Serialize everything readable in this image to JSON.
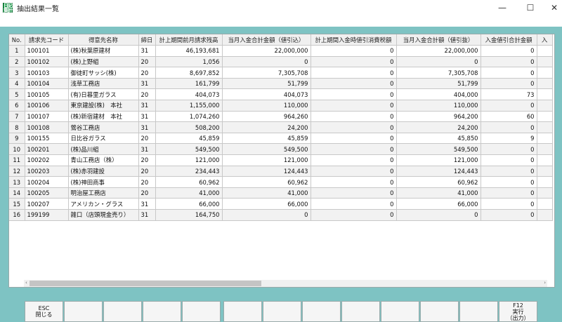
{
  "window": {
    "title": "抽出結果一覧",
    "icon_chars": [
      "日",
      "記",
      "集",
      "計"
    ],
    "min_glyph": "—",
    "max_glyph": "☐",
    "close_glyph": "✕"
  },
  "table": {
    "columns": [
      "No.",
      "請求先コード",
      "得意先名称",
      "締日",
      "計上期間前月請求残高",
      "当月入金合計金額（値引込）",
      "計上期間入金時値引消費税額",
      "当月入金合計額（値引抜）",
      "入金値引合計金額",
      "入"
    ],
    "rows": [
      [
        "1",
        "100101",
        "(株)秋葉原建材",
        "31",
        "46,193,681",
        "22,000,000",
        "0",
        "22,000,000",
        "0",
        ""
      ],
      [
        "2",
        "100102",
        "(株)上野組",
        "20",
        "1,056",
        "0",
        "0",
        "0",
        "0",
        ""
      ],
      [
        "3",
        "100103",
        "御徒町サッシ(株)",
        "20",
        "8,697,852",
        "7,305,708",
        "0",
        "7,305,708",
        "0",
        ""
      ],
      [
        "4",
        "100104",
        "浅草工務店",
        "31",
        "161,799",
        "51,799",
        "0",
        "51,799",
        "0",
        ""
      ],
      [
        "5",
        "100105",
        "(有)日暮里ガラス",
        "20",
        "404,073",
        "404,073",
        "0",
        "404,000",
        "73",
        ""
      ],
      [
        "6",
        "100106",
        "東京建設(株)　本社",
        "31",
        "1,155,000",
        "110,000",
        "0",
        "110,000",
        "0",
        ""
      ],
      [
        "7",
        "100107",
        "(株)新宿建材　本社",
        "31",
        "1,074,260",
        "964,260",
        "0",
        "964,200",
        "60",
        ""
      ],
      [
        "8",
        "100108",
        "鶯谷工務店",
        "31",
        "508,200",
        "24,200",
        "0",
        "24,200",
        "0",
        ""
      ],
      [
        "9",
        "100155",
        "日比谷ガラス",
        "20",
        "45,859",
        "45,859",
        "0",
        "45,850",
        "9",
        ""
      ],
      [
        "10",
        "100201",
        "(株)品川組",
        "31",
        "549,500",
        "549,500",
        "0",
        "549,500",
        "0",
        ""
      ],
      [
        "11",
        "100202",
        "青山工務店（株）",
        "20",
        "121,000",
        "121,000",
        "0",
        "121,000",
        "0",
        ""
      ],
      [
        "12",
        "100203",
        "(株)赤羽建設",
        "20",
        "234,443",
        "124,443",
        "0",
        "124,443",
        "0",
        ""
      ],
      [
        "13",
        "100204",
        "(株)神田商事",
        "20",
        "60,962",
        "60,962",
        "0",
        "60,962",
        "0",
        ""
      ],
      [
        "14",
        "100205",
        "明治屋工務店",
        "20",
        "41,000",
        "41,000",
        "0",
        "41,000",
        "0",
        ""
      ],
      [
        "15",
        "100207",
        "アメリカン・グラス",
        "31",
        "66,000",
        "66,000",
        "0",
        "66,000",
        "0",
        ""
      ],
      [
        "16",
        "199199",
        "雑口（店頭現金売り）",
        "31",
        "164,750",
        "0",
        "0",
        "0",
        "0",
        ""
      ]
    ]
  },
  "scrollbar": {
    "left_arrow": "‹",
    "right_arrow": "›"
  },
  "function_keys": {
    "esc": {
      "line1": "ESC",
      "line2": "閉じる"
    },
    "f12": {
      "line1": "F12",
      "line2": "実行",
      "line3": "（出力）"
    }
  },
  "colors": {
    "background": "#7ec3c3",
    "row_alt": "#f2f2f2"
  }
}
